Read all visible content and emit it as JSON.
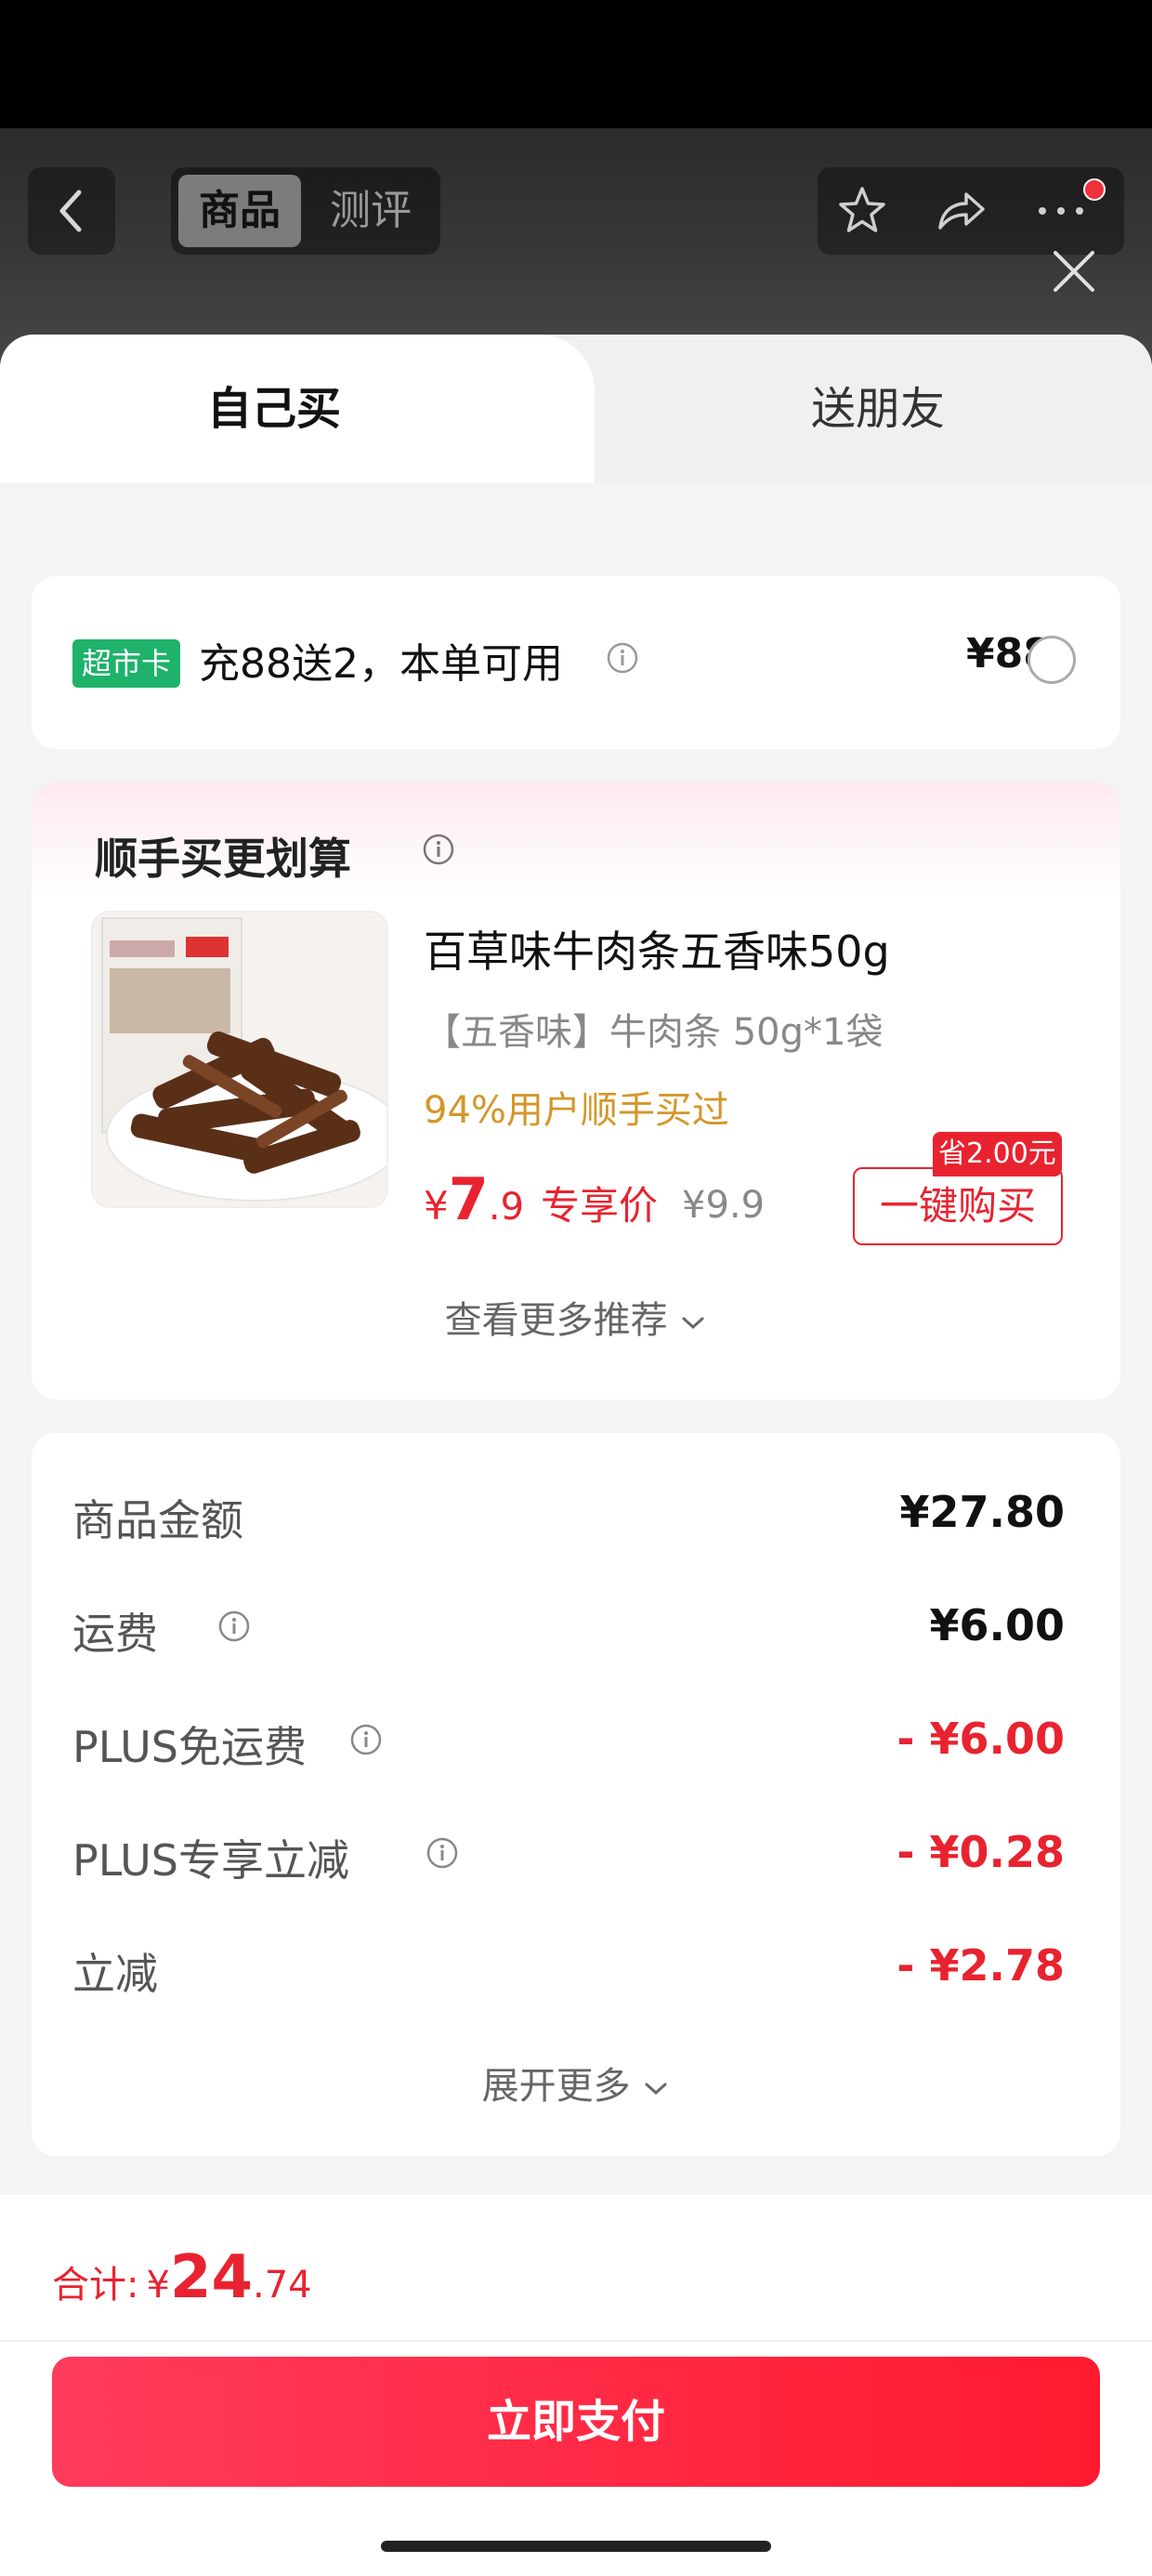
{
  "nav": {
    "tab_product": "商品",
    "tab_review": "测评"
  },
  "sheet_tabs": {
    "self": "自己买",
    "friend": "送朋友"
  },
  "promo": {
    "tag": "超市卡",
    "text": "充88送2，本单可用",
    "price": "¥88"
  },
  "recommend": {
    "title": "顺手买更划算",
    "product_name": "百草味牛肉条五香味50g",
    "spec": "【五香味】牛肉条 50g*1袋",
    "social": "94%用户顺手买过",
    "price_symbol": "¥",
    "price_int": "7",
    "price_dec": ".9",
    "price_label": "专享价",
    "price_orig": "¥9.9",
    "save_badge": "省2.00元",
    "buy_button": "一键购买",
    "more": "查看更多推荐"
  },
  "summary": {
    "rows": [
      {
        "label": "商品金额",
        "value": "¥27.80"
      },
      {
        "label": "运费",
        "value": "¥6.00"
      },
      {
        "label": "PLUS免运费",
        "value": "- ¥6.00"
      },
      {
        "label": "PLUS专享立减",
        "value": "- ¥0.28"
      },
      {
        "label": "立减",
        "value": "- ¥2.78"
      }
    ],
    "expand": "展开更多"
  },
  "footer": {
    "total_label": "合计:",
    "total_symbol": "¥",
    "total_int": "24",
    "total_dec": ".74",
    "pay_button": "立即支付"
  },
  "colors": {
    "accent_red": "#e8232f",
    "green_tag": "#1fb26b",
    "social_orange": "#d4962a"
  }
}
